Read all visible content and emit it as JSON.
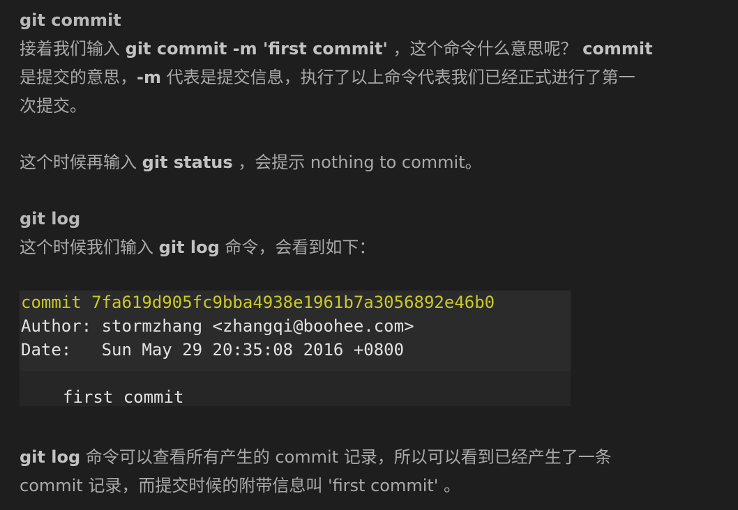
{
  "section1": {
    "heading": "git commit",
    "para1": {
      "t1": "接着我们输入 ",
      "b1": "git commit -m 'first commit'",
      "t2": " ，这个命令什么意思呢？ ",
      "b2": "commit",
      "t3": "是提交的意思，",
      "b3": "-m",
      "t4": " 代表是提交信息，执行了以上命令代表我们已经正式进行了第一",
      "t5": "次提交。"
    },
    "para2": {
      "t1": "这个时候再输入 ",
      "b1": "git status",
      "t2": " ，会提示 nothing to commit。"
    }
  },
  "section2": {
    "heading": "git log",
    "para1": {
      "t1": "这个时候我们输入 ",
      "b1": "git log",
      "t2": " 命令，会看到如下："
    },
    "terminal": {
      "commit_line": "commit 7fa619d905fc9bba4938e1961b7a3056892e46b0",
      "author_line": "Author: stormzhang <zhangqi@boohee.com>",
      "date_line": "Date:   Sun May 29 20:35:08 2016 +0800",
      "message_line": "first commit"
    },
    "para2": {
      "b1": "git log",
      "t1": " 命令可以查看所有产生的 commit 记录，所以可以看到已经产生了一条",
      "t2": "commit 记录，而提交时候的附带信息叫 'first commit' 。"
    }
  },
  "colors": {
    "background": "#1e1e1e",
    "text": "#a9a9a9",
    "bold_text": "#c2c2c2",
    "commit_hash": "#c9c92a",
    "terminal_bg": "#2b2b2b"
  }
}
